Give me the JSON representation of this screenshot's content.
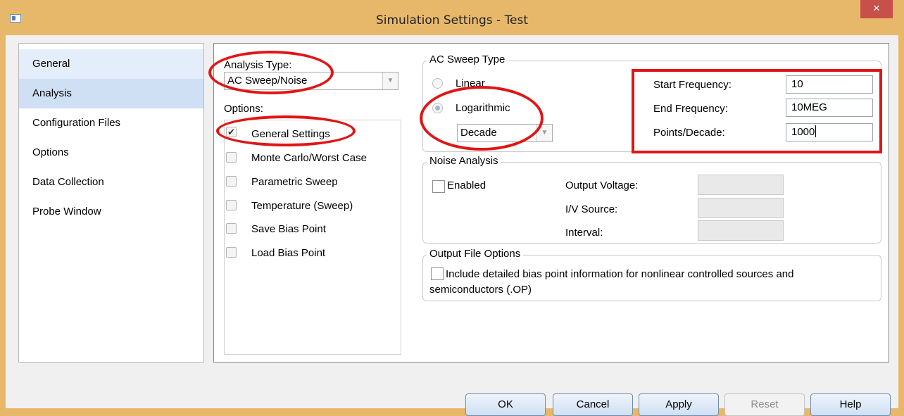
{
  "window": {
    "title": "Simulation Settings - Test",
    "close_glyph": "×"
  },
  "nav": {
    "items": [
      {
        "label": "General"
      },
      {
        "label": "Analysis"
      },
      {
        "label": "Configuration Files"
      },
      {
        "label": "Options"
      },
      {
        "label": "Data Collection"
      },
      {
        "label": "Probe Window"
      }
    ]
  },
  "analysis": {
    "type_label": "Analysis Type:",
    "type_value": "AC Sweep/Noise",
    "options_label": "Options:",
    "options": [
      {
        "label": "General Settings",
        "checked": true
      },
      {
        "label": "Monte Carlo/Worst Case",
        "checked": false
      },
      {
        "label": "Parametric Sweep",
        "checked": false
      },
      {
        "label": "Temperature (Sweep)",
        "checked": false
      },
      {
        "label": "Save Bias Point",
        "checked": false
      },
      {
        "label": "Load Bias Point",
        "checked": false
      }
    ]
  },
  "ac_sweep": {
    "group_title": "AC Sweep Type",
    "linear_label": "Linear",
    "logarithmic_label": "Logarithmic",
    "log_unit": "Decade",
    "start_label": "Start Frequency:",
    "start_value": "10",
    "end_label": "End Frequency:",
    "end_value": "10MEG",
    "points_label": "Points/Decade:",
    "points_value": "1000"
  },
  "noise": {
    "group_title": "Noise Analysis",
    "enabled_label": "Enabled",
    "output_voltage_label": "Output Voltage:",
    "iv_source_label": "I/V Source:",
    "interval_label": "Interval:"
  },
  "output_file": {
    "group_title": "Output File Options",
    "checkbox_label_line1": "Include detailed bias point information for nonlinear controlled sources and",
    "checkbox_label_line2": "semiconductors (.OP)"
  },
  "buttons": {
    "ok": "OK",
    "cancel": "Cancel",
    "apply": "Apply",
    "reset": "Reset",
    "help": "Help"
  },
  "colors": {
    "titlebar": "#e8b86a",
    "close_button": "#c7504a",
    "annotation_red": "#e01616",
    "nav_selected": "#cfe0f5"
  }
}
